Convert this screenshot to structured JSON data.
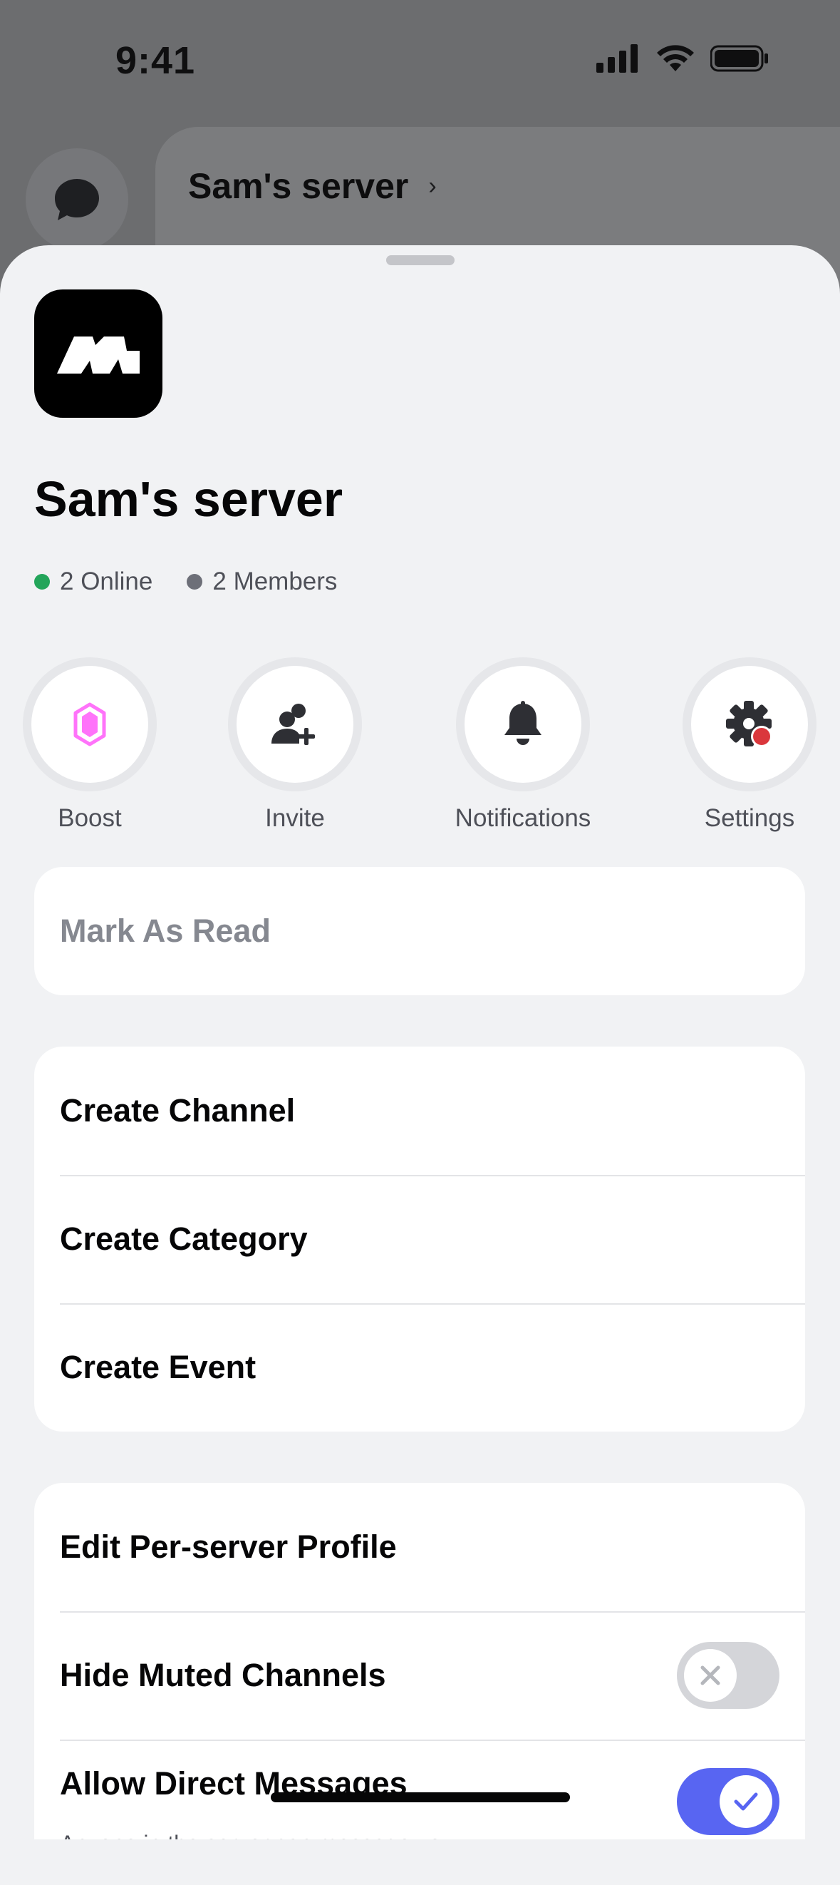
{
  "status_bar": {
    "time": "9:41"
  },
  "background": {
    "server_title": "Sam's server",
    "chevron": "›"
  },
  "sheet": {
    "server_name": "Sam's server",
    "stats": {
      "online": "2 Online",
      "members": "2 Members"
    },
    "actions": [
      {
        "label": "Boost",
        "icon": "boost-gem-icon"
      },
      {
        "label": "Invite",
        "icon": "invite-person-plus-icon"
      },
      {
        "label": "Notifications",
        "icon": "bell-icon"
      },
      {
        "label": "Settings",
        "icon": "gear-icon"
      }
    ],
    "mark_as_read": "Mark As Read",
    "create_group": {
      "channel": "Create Channel",
      "category": "Create Category",
      "event": "Create Event"
    },
    "settings_group": {
      "edit_profile": "Edit Per-server Profile",
      "hide_muted": "Hide Muted Channels",
      "hide_muted_on": false,
      "allow_dms": "Allow Direct Messages",
      "allow_dms_sub": "Anyone in the server can message you",
      "allow_dms_on": true
    }
  },
  "colors": {
    "accent": "#5865f2",
    "online": "#23a55a",
    "boost": "#ff73fa",
    "alert": "#da373c"
  }
}
